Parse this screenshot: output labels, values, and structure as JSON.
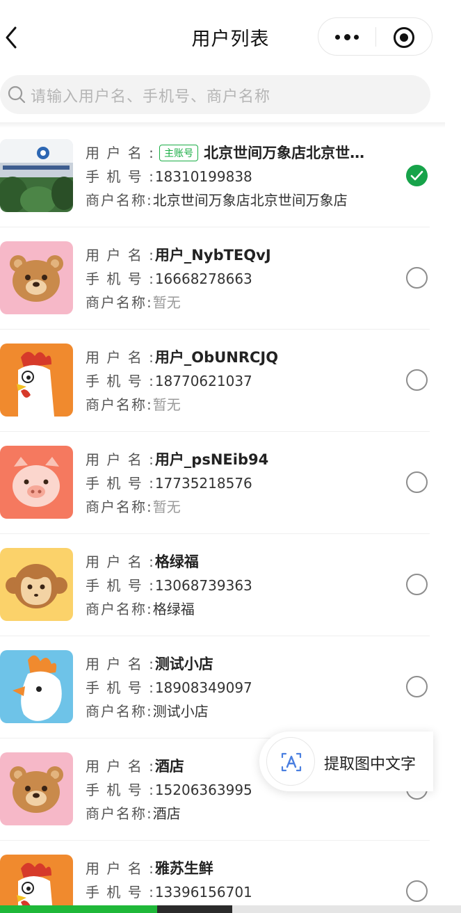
{
  "header": {
    "title": "用户列表"
  },
  "search": {
    "placeholder": "请输入用户名、手机号、商户名称"
  },
  "labels": {
    "username": "用 户 名 :",
    "phone": "手 机 号 :",
    "merchant": "商户名称:"
  },
  "badge_main": "主账号",
  "users": [
    {
      "username": "北京世间万象店北京世…",
      "phone": "18310199838",
      "merchant": "北京世间万象店北京世间万象店",
      "is_main": true,
      "selected": true,
      "avatar": "storefront-photo"
    },
    {
      "username": "用户_NybTEQvJ",
      "phone": "16668278663",
      "merchant": "暂无",
      "merchant_empty": true,
      "selected": false,
      "avatar": "bear-avatar"
    },
    {
      "username": "用户_ObUNRCJQ",
      "phone": "18770621037",
      "merchant": "暂无",
      "merchant_empty": true,
      "selected": false,
      "avatar": "rooster-avatar"
    },
    {
      "username": "用户_psNEib94",
      "phone": "17735218576",
      "merchant": "暂无",
      "merchant_empty": true,
      "selected": false,
      "avatar": "pig-avatar"
    },
    {
      "username": "格绿福",
      "phone": "13068739363",
      "merchant": "格绿福",
      "selected": false,
      "avatar": "monkey-avatar"
    },
    {
      "username": "测试小店",
      "phone": "18908349097",
      "merchant": "测试小店",
      "selected": false,
      "avatar": "chicken-avatar"
    },
    {
      "username": "酒店",
      "phone": "15206363995",
      "merchant": "酒店",
      "selected": false,
      "avatar": "bear-avatar"
    },
    {
      "username": "雅苏生鲜",
      "phone": "13396156701",
      "merchant": "",
      "selected": false,
      "avatar": "rooster-avatar"
    }
  ],
  "ocr_button": {
    "label": "提取图中文字"
  },
  "colors": {
    "accent_green": "#17a34a",
    "badge_green": "#1aad45"
  }
}
